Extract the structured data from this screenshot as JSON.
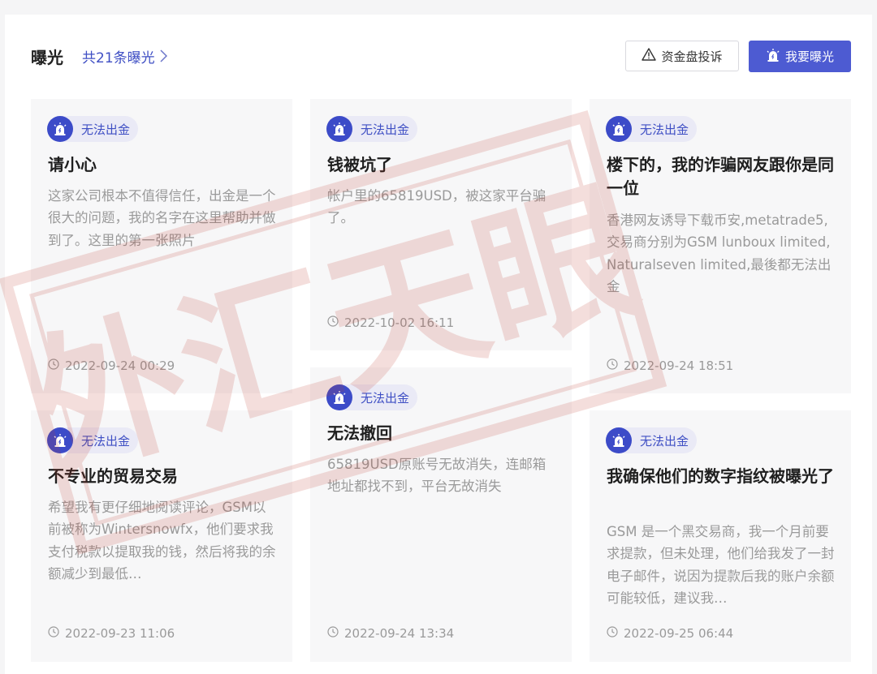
{
  "header": {
    "title": "曝光",
    "count_label": "共21条曝光",
    "complaint_button": "资金盘投诉",
    "expose_button": "我要曝光"
  },
  "watermark": {
    "text": "外汇天眼",
    "color": "#c0392b"
  },
  "colors": {
    "accent": "#4d5bd2",
    "badge_text": "#3f4fc4",
    "muted": "#9a9a9a"
  },
  "cards": [
    {
      "tag": "无法出金",
      "title": "请小心",
      "body": "这家公司根本不值得信任，出金是一个很大的问题，我的名字在这里帮助并做到了。这里的第一张照片",
      "time": "2022-09-24 00:29"
    },
    {
      "tag": "无法出金",
      "title": "钱被坑了",
      "body": "帐户里的65819USD，被这家平台骗了。",
      "time": "2022-10-02 16:11"
    },
    {
      "tag": "无法出金",
      "title": "楼下的，我的诈骗网友跟你是同一位",
      "body": "香港网友诱导下载币安,metatrade5,交易商分别为GSM lunboux limited, Naturalseven limited,最後都无法出金",
      "time": "2022-09-24 18:51"
    },
    {
      "tag": "无法出金",
      "title": "不专业的贸易交易",
      "body": "希望我有更仔细地阅读评论，GSM以前被称为Wintersnowfx，他们要求我支付税款以提取我的钱，然后将我的余额减少到最低…",
      "time": "2022-09-23 11:06"
    },
    {
      "tag": "无法出金",
      "title": "无法撤回",
      "body": "65819USD原账号无故消失，连邮箱地址都找不到，平台无故消失",
      "time": "2022-09-24 13:34"
    },
    {
      "tag": "无法出金",
      "title": "我确保他们的数字指纹被曝光了",
      "body": "GSM 是一个黑交易商，我一个月前要求提款，但未处理，他们给我发了一封电子邮件，说因为提款后我的账户余额可能较低，建议我…",
      "time": "2022-09-25 06:44"
    }
  ]
}
